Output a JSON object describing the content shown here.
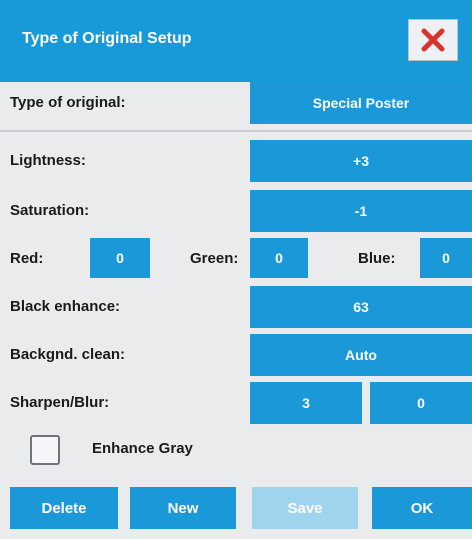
{
  "window": {
    "title": "Type of Original Setup",
    "close_icon": "close-x-icon",
    "close_color": "#d9342b"
  },
  "fields": {
    "type_of_original": {
      "label": "Type of original:",
      "value": "Special Poster"
    },
    "lightness": {
      "label": "Lightness:",
      "value": "+3"
    },
    "saturation": {
      "label": "Saturation:",
      "value": "-1"
    },
    "red": {
      "label": "Red:",
      "value": "0"
    },
    "green": {
      "label": "Green:",
      "value": "0"
    },
    "blue": {
      "label": "Blue:",
      "value": "0"
    },
    "black_enhance": {
      "label": "Black enhance:",
      "value": "63"
    },
    "backgnd_clean": {
      "label": "Backgnd. clean:",
      "value": "Auto"
    },
    "sharpen_blur": {
      "label": "Sharpen/Blur:",
      "sharpen": "3",
      "blur": "0"
    }
  },
  "enhance_gray": {
    "label": "Enhance Gray",
    "checked": false
  },
  "buttons": {
    "delete": "Delete",
    "new": "New",
    "save": "Save",
    "ok": "OK"
  },
  "colors": {
    "accent": "#1b98d8",
    "disabled": "#9fd3ee",
    "background": "#e9ebec"
  }
}
